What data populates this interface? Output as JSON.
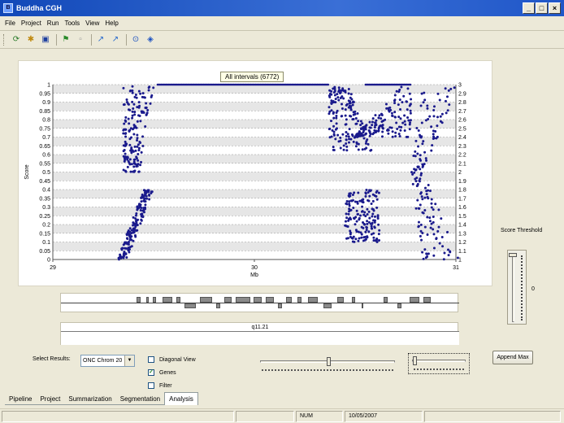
{
  "window": {
    "title": "Buddha CGH",
    "app_icon_glyph": "B",
    "controls": [
      "_",
      "□",
      "×"
    ]
  },
  "menu": [
    "File",
    "Project",
    "Run",
    "Tools",
    "View",
    "Help"
  ],
  "toolbar": {
    "icons": [
      "open-icon",
      "new-icon",
      "save-icon",
      "run-icon",
      "stop-icon",
      "zoom-in-icon",
      "zoom-out-icon",
      "help-icon",
      "info-icon"
    ],
    "glyphs": [
      "⟳",
      "✱",
      "▣",
      "⚑",
      "▫",
      "↗",
      "↗",
      "⊙",
      "◈"
    ]
  },
  "chart_data": {
    "type": "scatter",
    "title": "All intervals (6772)",
    "xlabel": "Mb",
    "ylabel": "Score",
    "xlim": [
      29,
      31
    ],
    "ylim": [
      0,
      1
    ],
    "y2lim": [
      1,
      3
    ],
    "x_ticks": [
      29,
      30,
      31
    ],
    "y_ticks": [
      0,
      0.05,
      0.1,
      0.15,
      0.2,
      0.25,
      0.3,
      0.35,
      0.4,
      0.45,
      0.5,
      0.55,
      0.6,
      0.65,
      0.7,
      0.75,
      0.8,
      0.85,
      0.9,
      0.95,
      1
    ],
    "y2_ticks": [
      1,
      1.1,
      1.2,
      1.3,
      1.4,
      1.5,
      1.6,
      1.7,
      1.8,
      1.9,
      2,
      2.1,
      2.2,
      2.3,
      2.4,
      2.5,
      2.6,
      2.7,
      2.8,
      2.9,
      3
    ],
    "grid": true,
    "point_color": "#1a1a8c",
    "clusters": [
      {
        "name": "",
        "x_range": [
          29.32,
          29.5
        ],
        "y_range": [
          0.0,
          0.4
        ]
      },
      {
        "name": "",
        "x_range": [
          29.35,
          29.52
        ],
        "y_range": [
          0.5,
          0.99
        ]
      },
      {
        "name": "",
        "x_range": [
          30.37,
          30.55
        ],
        "y_range": [
          0.62,
          0.99
        ]
      },
      {
        "name": "",
        "x_range": [
          30.45,
          30.8
        ],
        "y_range": [
          0.7,
          0.99
        ]
      },
      {
        "name": "",
        "x_range": [
          30.45,
          30.62
        ],
        "y_range": [
          0.1,
          0.4
        ]
      },
      {
        "name": "",
        "x_range": [
          30.78,
          30.98
        ],
        "y_range": [
          0.0,
          0.99
        ]
      }
    ]
  },
  "gene_track": {
    "genes": [
      {
        "start": 29.42,
        "end": 29.44,
        "strand": "+"
      },
      {
        "start": 29.47,
        "end": 29.48,
        "strand": "+"
      },
      {
        "start": 29.5,
        "end": 29.52,
        "strand": "+"
      },
      {
        "start": 29.55,
        "end": 29.6,
        "strand": "+"
      },
      {
        "start": 29.62,
        "end": 29.64,
        "strand": "+"
      },
      {
        "start": 29.66,
        "end": 29.72,
        "strand": "-"
      },
      {
        "start": 29.74,
        "end": 29.8,
        "strand": "+"
      },
      {
        "start": 29.82,
        "end": 29.84,
        "strand": "-"
      },
      {
        "start": 29.86,
        "end": 29.9,
        "strand": "+"
      },
      {
        "start": 29.92,
        "end": 29.99,
        "strand": "+"
      },
      {
        "start": 30.01,
        "end": 30.05,
        "strand": "+"
      },
      {
        "start": 30.07,
        "end": 30.11,
        "strand": "+"
      },
      {
        "start": 30.13,
        "end": 30.15,
        "strand": "-"
      },
      {
        "start": 30.17,
        "end": 30.2,
        "strand": "+"
      },
      {
        "start": 30.23,
        "end": 30.25,
        "strand": "+"
      },
      {
        "start": 30.28,
        "end": 30.33,
        "strand": "+"
      },
      {
        "start": 30.36,
        "end": 30.4,
        "strand": "-"
      },
      {
        "start": 30.43,
        "end": 30.46,
        "strand": "+"
      },
      {
        "start": 30.5,
        "end": 30.52,
        "strand": "+"
      },
      {
        "start": 30.55,
        "end": 30.56,
        "strand": "-"
      },
      {
        "start": 30.66,
        "end": 30.68,
        "strand": "+"
      },
      {
        "start": 30.73,
        "end": 30.75,
        "strand": "-"
      },
      {
        "start": 30.79,
        "end": 30.84,
        "strand": "+"
      },
      {
        "start": 30.86,
        "end": 30.9,
        "strand": "+"
      }
    ]
  },
  "band_track": {
    "label": "q11.21"
  },
  "score_threshold": {
    "label": "Score Threshold",
    "value": "0"
  },
  "append_max_label": "Append Max",
  "select_results": {
    "label": "Select Results:",
    "value": "ONC Chrom 20"
  },
  "checkboxes": [
    {
      "label": "Diagonal View",
      "checked": false
    },
    {
      "label": "Genes",
      "checked": true
    },
    {
      "label": "Filter",
      "checked": false
    }
  ],
  "tabs": [
    {
      "label": "Pipeline",
      "active": false
    },
    {
      "label": "Project",
      "active": false
    },
    {
      "label": "Summarization",
      "active": false
    },
    {
      "label": "Segmentation",
      "active": false
    },
    {
      "label": "Analysis",
      "active": true
    }
  ],
  "status": {
    "num": "NUM",
    "date": "10/05/2007"
  }
}
